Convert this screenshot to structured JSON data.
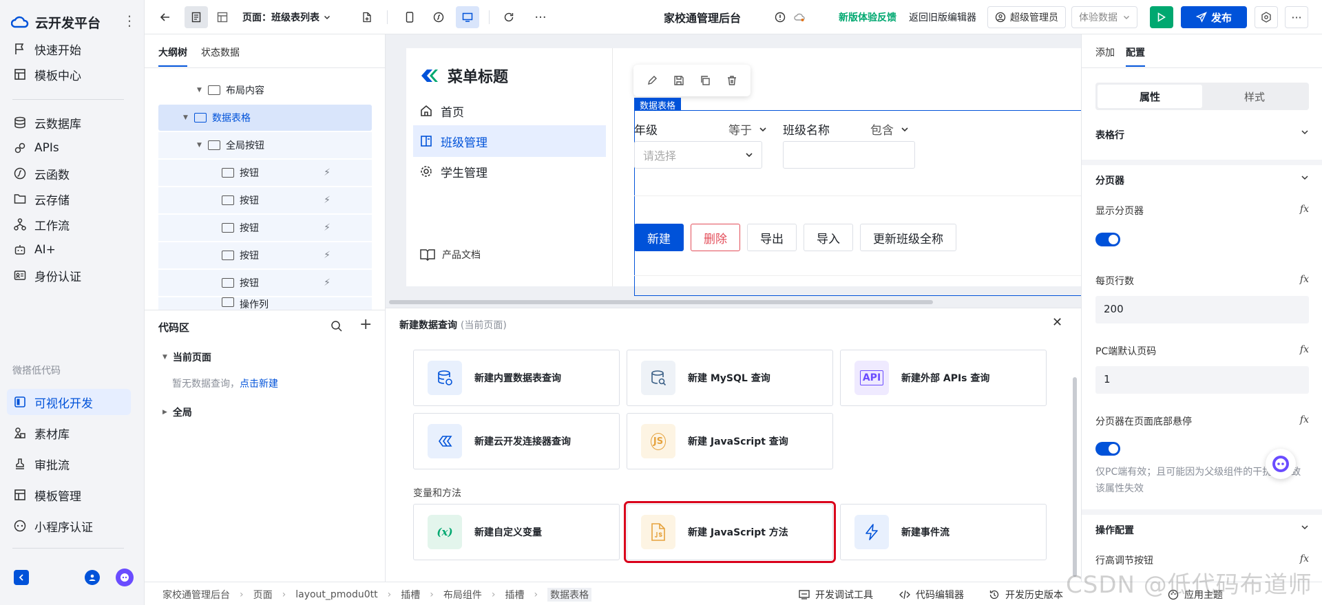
{
  "app": {
    "brand": "云开发平台"
  },
  "nav": {
    "items": [
      {
        "label": "快速开始"
      },
      {
        "label": "模板中心"
      },
      {
        "label": "云数据库"
      },
      {
        "label": "APIs"
      },
      {
        "label": "云函数"
      },
      {
        "label": "云存储"
      },
      {
        "label": "工作流"
      },
      {
        "label": "AI+"
      },
      {
        "label": "身份认证"
      },
      {
        "label": "可视化开发"
      },
      {
        "label": "素材库"
      },
      {
        "label": "审批流"
      },
      {
        "label": "模板管理"
      },
      {
        "label": "小程序认证"
      }
    ],
    "group_label": "微搭低代码"
  },
  "topbar": {
    "page_selector": "页面：班级表列表",
    "app_title": "家校通管理后台",
    "feedback": "新版体验反馈",
    "back_old": "返回旧版编辑器",
    "user": "超级管理员",
    "data_mode": "体验数据",
    "publish": "发布"
  },
  "outline": {
    "tabs": [
      "大纲树",
      "状态数据"
    ],
    "rows": [
      {
        "label": "布局内容"
      },
      {
        "label": "数据表格"
      },
      {
        "label": "全局按钮"
      },
      {
        "label": "按钮"
      },
      {
        "label": "按钮"
      },
      {
        "label": "按钮"
      },
      {
        "label": "按钮"
      },
      {
        "label": "按钮"
      },
      {
        "label": "操作列"
      }
    ]
  },
  "codearea": {
    "title": "代码区",
    "current_page": "当前页面",
    "empty_text": "暂无数据查询，",
    "create_link": "点击新建",
    "global": "全局"
  },
  "canvas": {
    "menu_title": "菜单标题",
    "menu_items": [
      "首页",
      "班级管理",
      "学生管理"
    ],
    "doc_link": "产品文档",
    "component_label": "数据表格",
    "filter": {
      "grade_label": "年级",
      "grade_op": "等于",
      "grade_placeholder": "请选择",
      "class_label": "班级名称",
      "class_op": "包含"
    },
    "buttons": [
      "新建",
      "删除",
      "导出",
      "导入",
      "更新班级全称"
    ]
  },
  "querypanel": {
    "title": "新建数据查询",
    "title_scope": "(当前页面)",
    "cards": [
      {
        "label": "新建内置数据表查询",
        "icon": "database-icon"
      },
      {
        "label": "新建 MySQL 查询",
        "icon": "mysql-icon"
      },
      {
        "label": "新建外部 APIs 查询",
        "icon": "api-icon"
      },
      {
        "label": "新建云开发连接器查询",
        "icon": "connector-icon"
      },
      {
        "label": "新建 JavaScript 查询",
        "icon": "js-query-icon"
      }
    ],
    "section_vars": "变量和方法",
    "var_cards": [
      {
        "label": "新建自定义变量",
        "icon": "variable-icon"
      },
      {
        "label": "新建 JavaScript 方法",
        "icon": "js-file-icon"
      },
      {
        "label": "新建事件流",
        "icon": "bolt-icon"
      }
    ],
    "api_text": "API",
    "js_text": "JS",
    "var_text": "(x)"
  },
  "rightpanel": {
    "tabs": [
      "添加",
      "配置"
    ],
    "seg": [
      "属性",
      "样式"
    ],
    "section_row": "表格行",
    "section_pager": "分页器",
    "show_pager": "显示分页器",
    "rows_per_page": "每页行数",
    "rows_per_page_value": "200",
    "pc_default_page": "PC端默认页码",
    "pc_default_page_value": "1",
    "pager_fixed": "分页器在页面底部悬停",
    "pager_note": "仅PC端有效；且可能因为父级组件的干扰，导致该属性失效",
    "section_ops": "操作配置",
    "row_height_btn": "行高调节按钮",
    "fx": "fx"
  },
  "statusbar": {
    "crumbs": [
      "家校通管理后台",
      "页面",
      "layout_pmodu0tt",
      "插槽",
      "布局组件",
      "插槽",
      "数据表格"
    ],
    "dev_tools": "开发调试工具",
    "code_editor": "代码编辑器",
    "history": "开发历史版本",
    "theme": "应用主题"
  },
  "watermark": "CSDN @低代码布道师",
  "colors": {
    "primary": "#0052d9",
    "highlight_border": "#d9001b",
    "success": "#00a870",
    "danger": "#e34d59"
  }
}
